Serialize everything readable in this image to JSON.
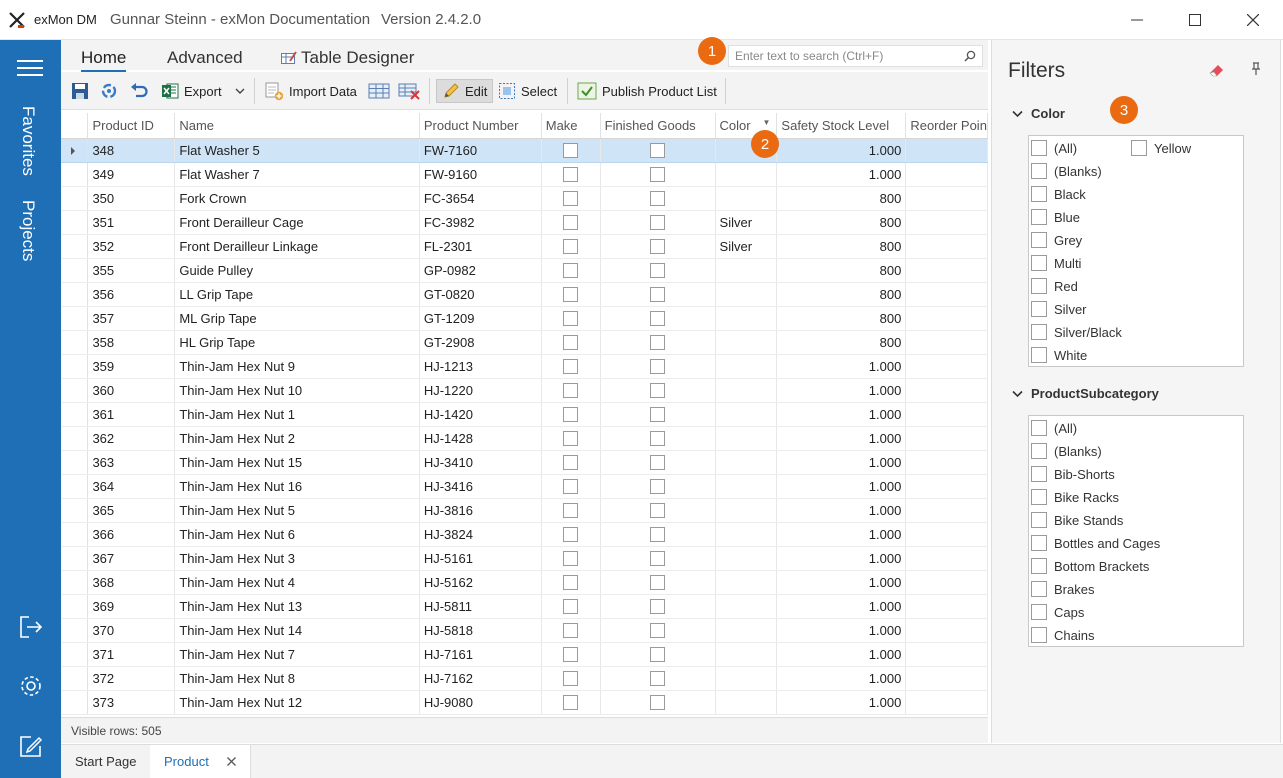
{
  "window": {
    "app_name": "exMon DM",
    "document": "Gunnar Steinn - exMon Documentation",
    "version": "Version 2.4.2.0"
  },
  "nav": {
    "favorites": "Favorites",
    "projects": "Projects"
  },
  "ribbon": {
    "tabs": [
      "Home",
      "Advanced",
      "Table Designer"
    ],
    "search_placeholder": "Enter text to search (Ctrl+F)",
    "toolbar": {
      "export": "Export",
      "import_data": "Import Data",
      "edit": "Edit",
      "select": "Select",
      "publish": "Publish Product List"
    }
  },
  "grid": {
    "columns": [
      "Product ID",
      "Name",
      "Product Number",
      "Make",
      "Finished Goods",
      "Color",
      "Safety Stock Level",
      "Reorder Poin"
    ],
    "rows": [
      {
        "id": "348",
        "name": "Flat Washer 5",
        "number": "FW-7160",
        "color": "",
        "safety": "1.000"
      },
      {
        "id": "349",
        "name": "Flat Washer 7",
        "number": "FW-9160",
        "color": "",
        "safety": "1.000"
      },
      {
        "id": "350",
        "name": "Fork Crown",
        "number": "FC-3654",
        "color": "",
        "safety": "800"
      },
      {
        "id": "351",
        "name": "Front Derailleur Cage",
        "number": "FC-3982",
        "color": "Silver",
        "safety": "800"
      },
      {
        "id": "352",
        "name": "Front Derailleur Linkage",
        "number": "FL-2301",
        "color": "Silver",
        "safety": "800"
      },
      {
        "id": "355",
        "name": "Guide Pulley",
        "number": "GP-0982",
        "color": "",
        "safety": "800"
      },
      {
        "id": "356",
        "name": "LL Grip Tape",
        "number": "GT-0820",
        "color": "",
        "safety": "800"
      },
      {
        "id": "357",
        "name": "ML Grip Tape",
        "number": "GT-1209",
        "color": "",
        "safety": "800"
      },
      {
        "id": "358",
        "name": "HL Grip Tape",
        "number": "GT-2908",
        "color": "",
        "safety": "800"
      },
      {
        "id": "359",
        "name": "Thin-Jam Hex Nut 9",
        "number": "HJ-1213",
        "color": "",
        "safety": "1.000"
      },
      {
        "id": "360",
        "name": "Thin-Jam Hex Nut 10",
        "number": "HJ-1220",
        "color": "",
        "safety": "1.000"
      },
      {
        "id": "361",
        "name": "Thin-Jam Hex Nut 1",
        "number": "HJ-1420",
        "color": "",
        "safety": "1.000"
      },
      {
        "id": "362",
        "name": "Thin-Jam Hex Nut 2",
        "number": "HJ-1428",
        "color": "",
        "safety": "1.000"
      },
      {
        "id": "363",
        "name": "Thin-Jam Hex Nut 15",
        "number": "HJ-3410",
        "color": "",
        "safety": "1.000"
      },
      {
        "id": "364",
        "name": "Thin-Jam Hex Nut 16",
        "number": "HJ-3416",
        "color": "",
        "safety": "1.000"
      },
      {
        "id": "365",
        "name": "Thin-Jam Hex Nut 5",
        "number": "HJ-3816",
        "color": "",
        "safety": "1.000"
      },
      {
        "id": "366",
        "name": "Thin-Jam Hex Nut 6",
        "number": "HJ-3824",
        "color": "",
        "safety": "1.000"
      },
      {
        "id": "367",
        "name": "Thin-Jam Hex Nut 3",
        "number": "HJ-5161",
        "color": "",
        "safety": "1.000"
      },
      {
        "id": "368",
        "name": "Thin-Jam Hex Nut 4",
        "number": "HJ-5162",
        "color": "",
        "safety": "1.000"
      },
      {
        "id": "369",
        "name": "Thin-Jam Hex Nut 13",
        "number": "HJ-5811",
        "color": "",
        "safety": "1.000"
      },
      {
        "id": "370",
        "name": "Thin-Jam Hex Nut 14",
        "number": "HJ-5818",
        "color": "",
        "safety": "1.000"
      },
      {
        "id": "371",
        "name": "Thin-Jam Hex Nut 7",
        "number": "HJ-7161",
        "color": "",
        "safety": "1.000"
      },
      {
        "id": "372",
        "name": "Thin-Jam Hex Nut 8",
        "number": "HJ-7162",
        "color": "",
        "safety": "1.000"
      },
      {
        "id": "373",
        "name": "Thin-Jam Hex Nut 12",
        "number": "HJ-9080",
        "color": "",
        "safety": "1.000"
      }
    ],
    "selected_row_index": 0,
    "status": "Visible rows: 505"
  },
  "doc_tabs": [
    "Start Page",
    "Product"
  ],
  "filters": {
    "title": "Filters",
    "color": {
      "label": "Color",
      "items": [
        "(All)",
        "Yellow",
        "(Blanks)",
        "Black",
        "Blue",
        "Grey",
        "Multi",
        "Red",
        "Silver",
        "Silver/Black",
        "White"
      ]
    },
    "subcategory": {
      "label": "ProductSubcategory",
      "items": [
        "(All)",
        "(Blanks)",
        "Bib-Shorts",
        "Bike Racks",
        "Bike Stands",
        "Bottles and Cages",
        "Bottom Brackets",
        "Brakes",
        "Caps",
        "Chains"
      ]
    }
  },
  "badges": [
    "1",
    "2",
    "3"
  ],
  "colors": {
    "accent": "#1f6fb6",
    "badge": "#ea6a12",
    "selected_row": "#cfe4f6"
  }
}
